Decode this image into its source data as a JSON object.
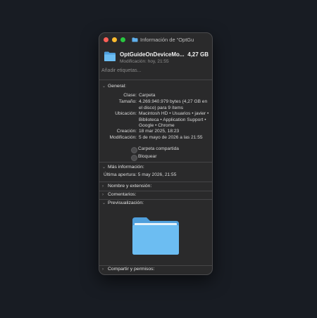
{
  "window": {
    "title": "Información de “OptGu"
  },
  "header": {
    "name": "OptGuideOnDeviceMo...",
    "size": "4,27 GB",
    "modified": "Modificación: hoy, 21:55"
  },
  "tags_placeholder": "Añadir etiquetas...",
  "general": {
    "heading": "General:",
    "rows": [
      {
        "label": "Clase:",
        "value": "Carpeta"
      },
      {
        "label": "Tamaño:",
        "value": "4.269.940.979 bytes (4,27 GB en el disco) para 9 ítems"
      },
      {
        "label": "Ubicación:",
        "value": "Macintosh HD • Usuarios • javier • Biblioteca • Application Support • Google • Chrome"
      },
      {
        "label": "Creación:",
        "value": "18 mar 2025, 18:23"
      },
      {
        "label": "Modificación:",
        "value": "5 de mayo de 2026 a las 21:55"
      }
    ],
    "shared_folder": "Carpeta compartida",
    "locked": "Bloquear"
  },
  "more_info": {
    "heading": "Más información:",
    "last_opened": "Última apertura: 5 may 2026, 21:55"
  },
  "sections": {
    "name_ext": "Nombre y extensión:",
    "comments": "Comentarios:",
    "preview": "Previsualización:",
    "sharing": "Compartir y permisos:"
  },
  "colors": {
    "window_bg": "#2a2a2b",
    "folder_blue": "#5fb0ec",
    "close": "#ff5f57",
    "minimize": "#febc2e",
    "zoom": "#28c840"
  }
}
